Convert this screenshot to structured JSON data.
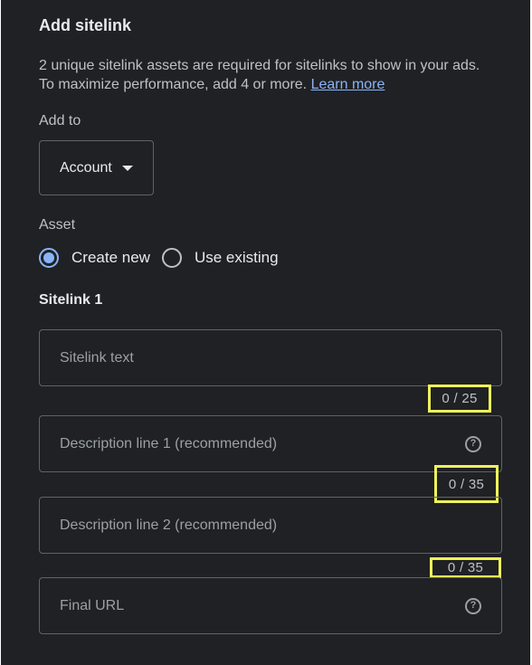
{
  "dialog": {
    "title": "Add sitelink",
    "description": "2 unique sitelink assets are required for sitelinks to show in your ads. To maximize performance, add 4 or more.",
    "learn_more": "Learn more"
  },
  "add_to": {
    "label": "Add to",
    "selected": "Account"
  },
  "asset": {
    "label": "Asset",
    "options": [
      {
        "label": "Create new",
        "selected": true
      },
      {
        "label": "Use existing",
        "selected": false
      }
    ]
  },
  "sitelink": {
    "heading": "Sitelink 1",
    "fields": [
      {
        "placeholder": "Sitelink text",
        "counter": "0 / 25"
      },
      {
        "placeholder": "Description line 1 (recommended)",
        "counter": "0 / 35"
      },
      {
        "placeholder": "Description line 2 (recommended)",
        "counter": "0 / 35"
      },
      {
        "placeholder": "Final URL"
      }
    ]
  },
  "colors": {
    "background": "#202124",
    "accent": "#8ab4f8",
    "highlight": "#eef45a"
  },
  "icons": [
    "chevron-down-icon",
    "help-icon"
  ]
}
